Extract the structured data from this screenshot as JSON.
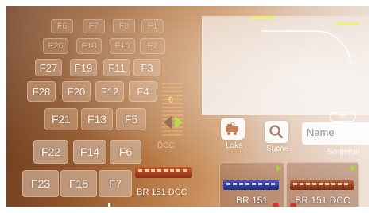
{
  "function_keys": [
    {
      "label": "F6",
      "row": "top"
    },
    {
      "label": "F7",
      "row": "top"
    },
    {
      "label": "F8",
      "row": "top"
    },
    {
      "label": "F1",
      "row": "top"
    },
    {
      "label": "F26",
      "row": "r2"
    },
    {
      "label": "F18",
      "row": "r2"
    },
    {
      "label": "F10",
      "row": "r2"
    },
    {
      "label": "F2",
      "row": "r2"
    },
    {
      "label": "F27",
      "row": "r3"
    },
    {
      "label": "F19",
      "row": "r3"
    },
    {
      "label": "F11",
      "row": "r3"
    },
    {
      "label": "F3",
      "row": "r3"
    },
    {
      "label": "F28",
      "row": "r4"
    },
    {
      "label": "F20",
      "row": "r4"
    },
    {
      "label": "F12",
      "row": "r4"
    },
    {
      "label": "F4",
      "row": "r4"
    },
    {
      "label": "F21",
      "row": "r5"
    },
    {
      "label": "F13",
      "row": "r5"
    },
    {
      "label": "F5",
      "row": "r5"
    },
    {
      "label": "F22",
      "row": "r6"
    },
    {
      "label": "F14",
      "row": "r6"
    },
    {
      "label": "F6",
      "row": "r6"
    },
    {
      "label": "F23",
      "row": "r7"
    },
    {
      "label": "F15",
      "row": "r7"
    },
    {
      "label": "F7",
      "row": "r7"
    }
  ],
  "throttle": {
    "speed": "0",
    "protocol": "DCC"
  },
  "active_loco": {
    "name": "BR 151 DCC"
  },
  "toolbar": {
    "loks_label": "Loks",
    "suche_label": "Suche",
    "name_placeholder": "Name",
    "sort_label": "Sortierun",
    "m_badge": "m"
  },
  "loco_list": [
    {
      "name": "BR 151",
      "color": "#3a54d8"
    },
    {
      "name": "BR 151 DCC",
      "color": "#b85a30"
    }
  ],
  "colors": {
    "accent_green": "#a6d21a",
    "speed_yellow": "#e8d43a"
  }
}
